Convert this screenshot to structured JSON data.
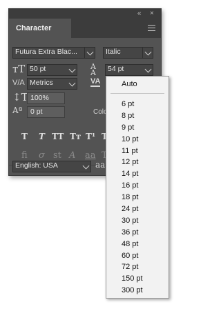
{
  "window": {
    "collapse_glyph": "«",
    "close_glyph": "×"
  },
  "tab": {
    "label": "Character"
  },
  "font": {
    "family": "Futura Extra Blac...",
    "style": "Italic"
  },
  "size": {
    "value": "50 pt"
  },
  "leading": {
    "value": "54 pt"
  },
  "kerning": {
    "value": "Metrics"
  },
  "tracking_icon": "VA",
  "vertical_scale": {
    "value": "100%"
  },
  "baseline_shift": {
    "value": "0 pt"
  },
  "color_label": "Colo",
  "type_styles": [
    "T",
    "T",
    "TT",
    "Tт",
    "T¹",
    "T"
  ],
  "opentype": [
    "fi",
    "σ",
    "st",
    "A",
    "aa",
    "T"
  ],
  "language": {
    "value": "English: USA"
  },
  "antialias_icon": "aa",
  "leading_menu": {
    "auto": "Auto",
    "options": [
      "6 pt",
      "8 pt",
      "9 pt",
      "10 pt",
      "11 pt",
      "12 pt",
      "14 pt",
      "16 pt",
      "18 pt",
      "24 pt",
      "30 pt",
      "36 pt",
      "48 pt",
      "60 pt",
      "72 pt",
      "150 pt",
      "300 pt"
    ]
  }
}
